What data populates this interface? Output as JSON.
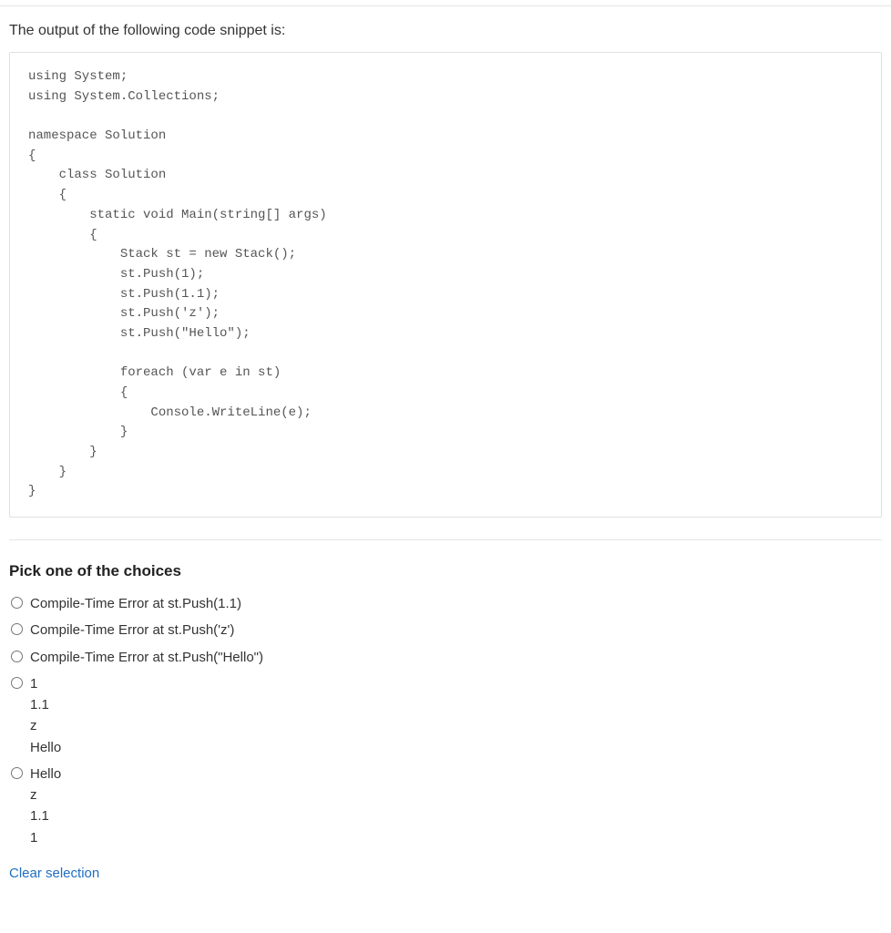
{
  "question": {
    "prompt": "The output of the following code snippet is:",
    "code": "using System;\nusing System.Collections;\n\nnamespace Solution\n{\n    class Solution\n    {\n        static void Main(string[] args)\n        {\n            Stack st = new Stack();\n            st.Push(1);\n            st.Push(1.1);\n            st.Push('z');\n            st.Push(\"Hello\");\n\n            foreach (var e in st)\n            {\n                Console.WriteLine(e);\n            }\n        }\n    }\n}"
  },
  "choices": {
    "heading": "Pick one of the choices",
    "items": [
      "Compile-Time Error at st.Push(1.1)",
      "Compile-Time Error at st.Push('z')",
      "Compile-Time Error at st.Push(\"Hello\")",
      "1\n1.1\nz\nHello",
      "Hello\nz\n1.1\n1"
    ]
  },
  "clear_label": "Clear selection"
}
